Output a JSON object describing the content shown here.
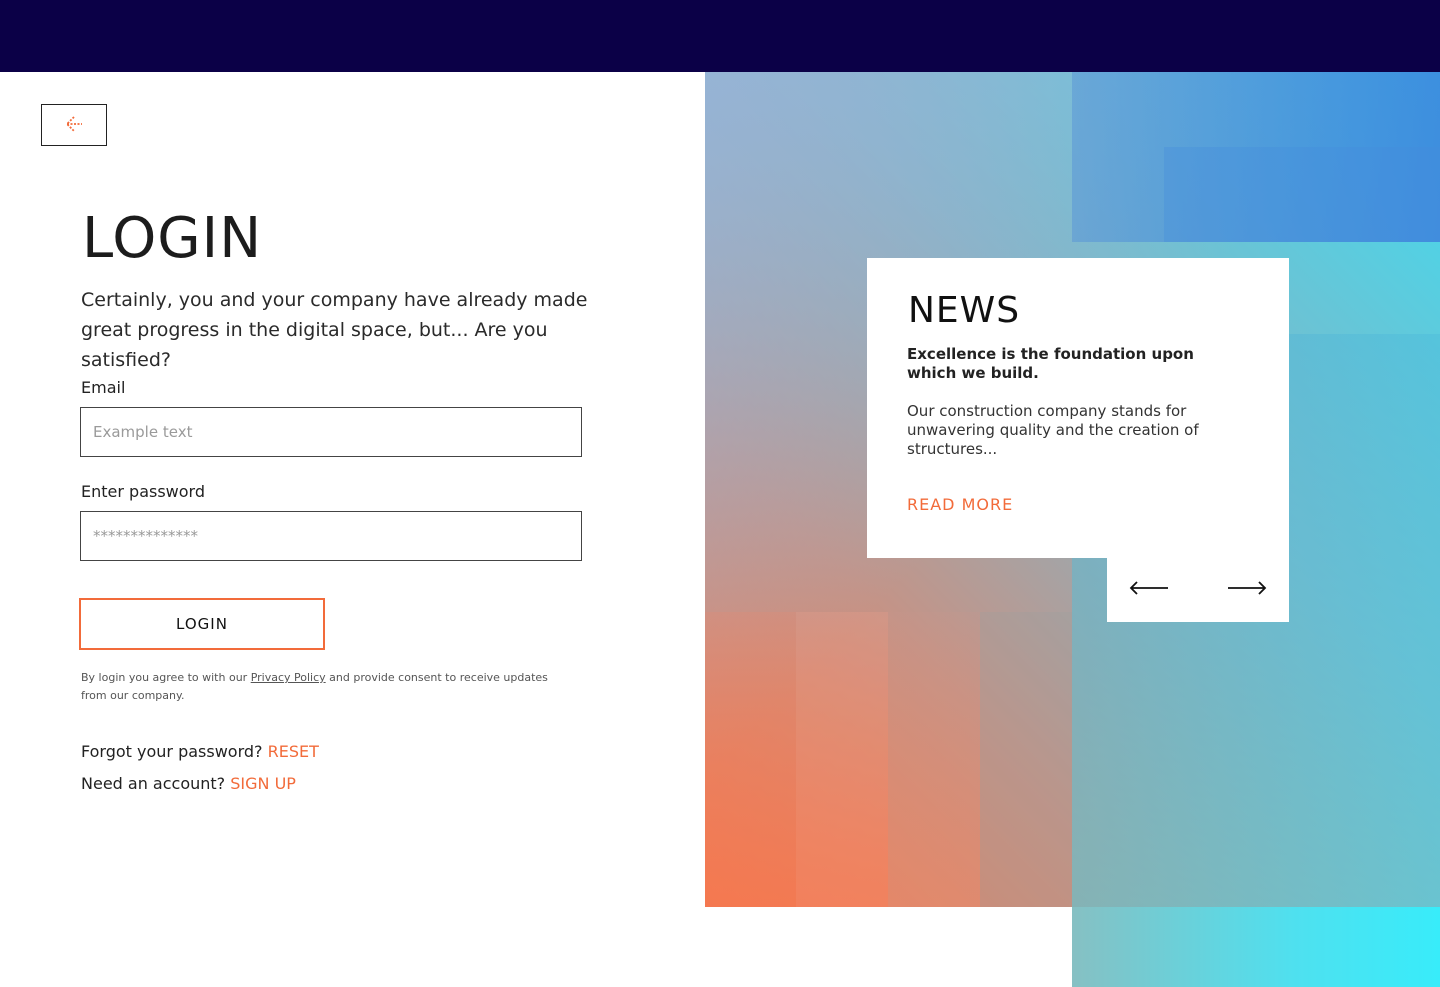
{
  "header": {},
  "back_button": {
    "icon": "arrow-left-icon"
  },
  "login": {
    "title": "LOGIN",
    "intro": "Certainly, you and your company have already made great progress in the digital space, but... Are you satisfied?",
    "email_label": "Email",
    "email_placeholder": "Example text",
    "password_label": "Enter password",
    "password_placeholder": "**************",
    "submit_label": "LOGIN",
    "consent_prefix": "By login you agree to with our ",
    "privacy_link": "Privacy Policy",
    "consent_suffix": " and provide consent to receive updates from our company.",
    "forgot_text": "Forgot your password?",
    "reset_link": "RESET",
    "account_text": "Need an account?",
    "signup_link": "SIGN UP"
  },
  "news": {
    "title": "NEWS",
    "headline": "Excellence is the foundation upon which we build.",
    "body": "Our construction company stands for unwavering quality and the creation of structures...",
    "read_more": "READ MORE",
    "prev_icon": "arrow-left-long-icon",
    "next_icon": "arrow-right-long-icon"
  },
  "colors": {
    "header_bg": "#0b0047",
    "accent": "#f26b3a",
    "gradient_orange": "#f47a4f",
    "gradient_cyan": "#3fdcf0",
    "gradient_blue": "#4a87d8"
  }
}
